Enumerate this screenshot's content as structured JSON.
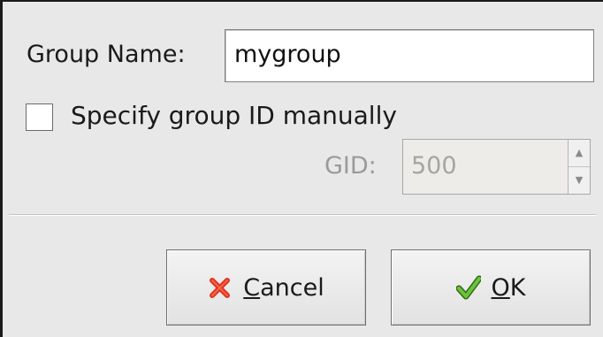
{
  "dialog": {
    "group_name_label": "Group Name:",
    "group_name_value": "mygroup",
    "specify_gid_label": "Specify group ID manually",
    "specify_gid_checked": false,
    "gid_label": "GID:",
    "gid_value": "500"
  },
  "buttons": {
    "cancel": {
      "mnemonic": "C",
      "rest": "ancel",
      "icon": "cancel-x-icon"
    },
    "ok": {
      "mnemonic": "O",
      "rest": "K",
      "icon": "checkmark-icon"
    }
  },
  "colors": {
    "cancel_icon": "#e2331c",
    "ok_icon": "#5aa22c"
  }
}
